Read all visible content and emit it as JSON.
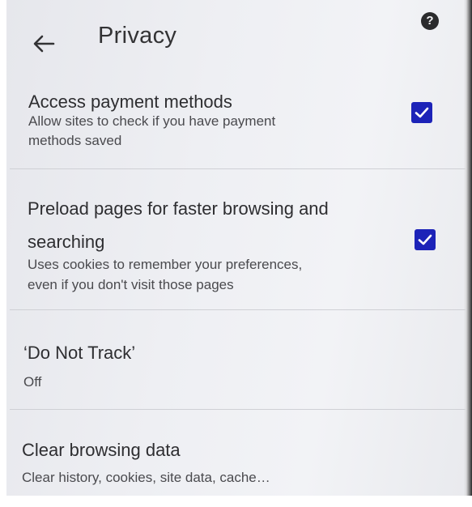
{
  "header": {
    "title": "Privacy",
    "back_icon": "arrow-left-icon",
    "help_icon": "help-circle-icon",
    "help_glyph": "?"
  },
  "settings": [
    {
      "title_lines": [
        "Access payment methods"
      ],
      "subtitle_lines": [
        "Allow sites to check if you have payment",
        "methods saved"
      ],
      "checked": true
    },
    {
      "title_lines": [
        "Preload pages for faster browsing and",
        "searching"
      ],
      "subtitle_lines": [
        "Uses cookies to remember your preferences,",
        "even if you don't visit those pages"
      ],
      "checked": true
    },
    {
      "title_lines": [
        "‘Do Not Track’"
      ],
      "subtitle_lines": [
        "Off"
      ]
    },
    {
      "title_lines": [
        "Clear browsing data"
      ],
      "subtitle_lines": [
        "Clear history, cookies, site data, cache…"
      ]
    }
  ],
  "colors": {
    "checkbox": "#1c23b8",
    "text_primary": "#2e2e31",
    "text_secondary": "#4a4a4e"
  }
}
